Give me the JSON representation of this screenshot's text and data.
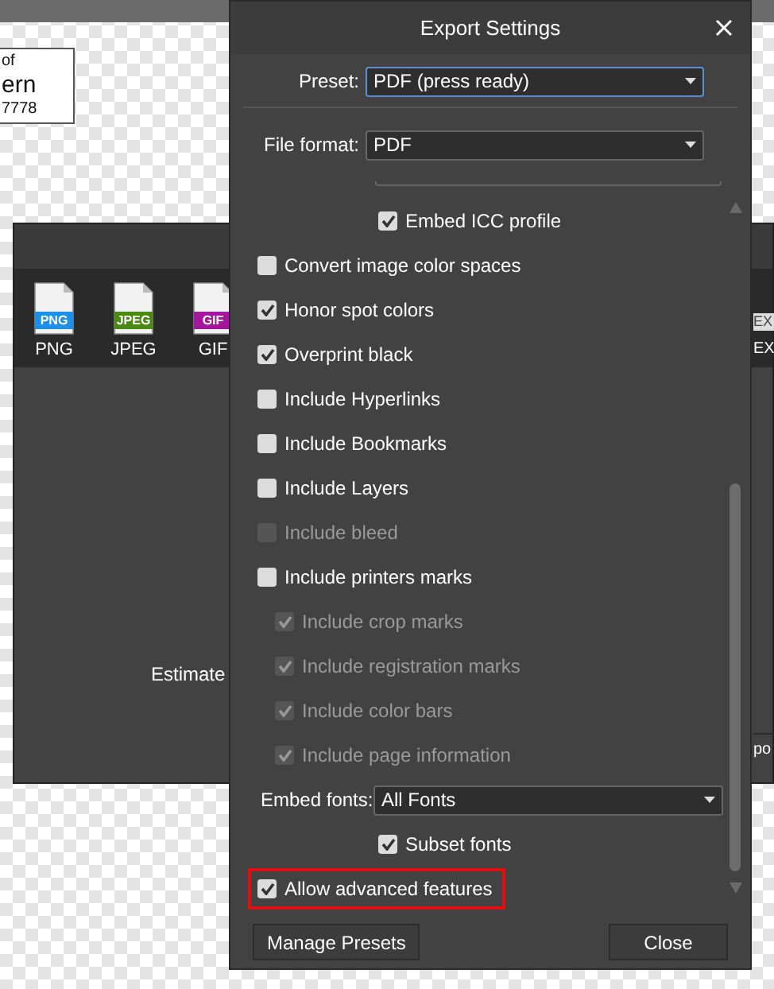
{
  "document_card": {
    "lines": [
      {
        "text": "of",
        "kind": "small"
      },
      {
        "text": "ern",
        "kind": "large"
      },
      {
        "text": "7778",
        "kind": "small"
      }
    ]
  },
  "export_panel": {
    "formats": [
      {
        "badge": "PNG",
        "label": "PNG",
        "color": "#1c8fe6"
      },
      {
        "badge": "JPEG",
        "label": "JPEG",
        "color": "#4b8a12"
      },
      {
        "badge": "GIF",
        "label": "GIF",
        "color": "#a3179c"
      }
    ],
    "right_format": {
      "badge": "EX",
      "label": "EX"
    },
    "estimate_label": "Estimate",
    "right_label": "po"
  },
  "dialog": {
    "title": "Export Settings",
    "preset": {
      "label": "Preset:",
      "value": "PDF (press ready)"
    },
    "file_format": {
      "label": "File format:",
      "value": "PDF"
    },
    "options": [
      {
        "kind": "nested",
        "label": "Embed ICC profile",
        "checked": true,
        "disabled": false
      },
      {
        "kind": "checkbox",
        "label": "Convert image color spaces",
        "checked": false,
        "disabled": false
      },
      {
        "kind": "checkbox",
        "label": "Honor spot colors",
        "checked": true,
        "disabled": false
      },
      {
        "kind": "checkbox",
        "label": "Overprint black",
        "checked": true,
        "disabled": false
      },
      {
        "kind": "checkbox",
        "label": "Include Hyperlinks",
        "checked": false,
        "disabled": false
      },
      {
        "kind": "checkbox",
        "label": "Include Bookmarks",
        "checked": false,
        "disabled": false
      },
      {
        "kind": "checkbox",
        "label": "Include Layers",
        "checked": false,
        "disabled": false
      },
      {
        "kind": "checkbox",
        "label": "Include bleed",
        "checked": false,
        "disabled": true
      },
      {
        "kind": "checkbox",
        "label": "Include printers marks",
        "checked": false,
        "disabled": false,
        "children": [
          {
            "kind": "checkbox",
            "label": "Include crop marks",
            "checked": true,
            "disabled": true
          },
          {
            "kind": "checkbox",
            "label": "Include registration marks",
            "checked": true,
            "disabled": true
          },
          {
            "kind": "checkbox",
            "label": "Include color bars",
            "checked": true,
            "disabled": true
          },
          {
            "kind": "checkbox",
            "label": "Include page information",
            "checked": true,
            "disabled": true
          }
        ]
      },
      {
        "kind": "dropdown",
        "label": "Embed fonts:",
        "value": "All Fonts"
      },
      {
        "kind": "nested",
        "label": "Subset fonts",
        "checked": true,
        "disabled": false
      },
      {
        "kind": "checkbox",
        "label": "Allow advanced features",
        "checked": true,
        "disabled": false,
        "highlighted": true
      }
    ],
    "buttons": [
      {
        "label": "Manage Presets"
      },
      {
        "label": "Close"
      }
    ]
  }
}
